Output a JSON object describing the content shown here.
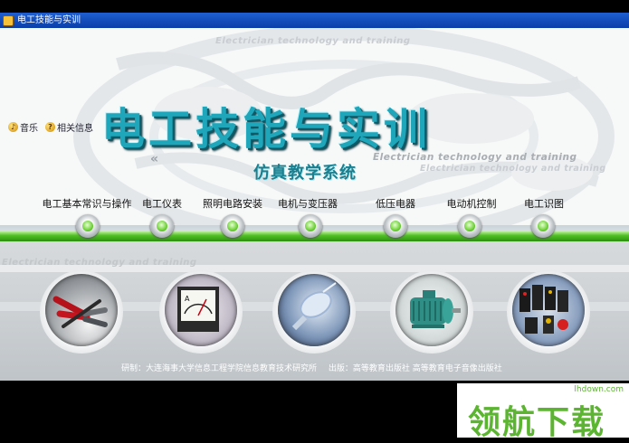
{
  "window": {
    "title": "电工技能与实训"
  },
  "background_text": {
    "top": "Electrician technology and training",
    "right1": "Electrician technology and training",
    "right2": "Electrician  technology   and   training",
    "left": "Electrician  technology   and   training"
  },
  "logo": {
    "main": "电工技能与实训",
    "sub": "仿真教学系统"
  },
  "side_options": [
    {
      "label": "音乐",
      "icon": "music-icon"
    },
    {
      "label": "相关信息",
      "icon": "info-icon"
    }
  ],
  "menu": [
    {
      "label": "电工基本常识与操作"
    },
    {
      "label": "电工仪表"
    },
    {
      "label": "照明电路安装"
    },
    {
      "label": "电机与变压器"
    },
    {
      "label": "低压电器"
    },
    {
      "label": "电动机控制"
    },
    {
      "label": "电工识图"
    }
  ],
  "images": [
    {
      "name": "tools-image"
    },
    {
      "name": "meter-image"
    },
    {
      "name": "lamp-image"
    },
    {
      "name": "motor-image"
    },
    {
      "name": "switches-image"
    }
  ],
  "footer": {
    "dev_label": "研制：",
    "dev_value": "大连海事大学信息工程学院信息教育技术研究所",
    "pub_label": "出版：",
    "pub_value": "高等教育出版社  高等教育电子音像出版社"
  },
  "watermark": {
    "text": "领航下载",
    "url": "lhdown.com"
  },
  "colors": {
    "title_bar": "#0a3ea8",
    "accent_green": "#52c126",
    "logo_teal": "#20a6ba"
  }
}
